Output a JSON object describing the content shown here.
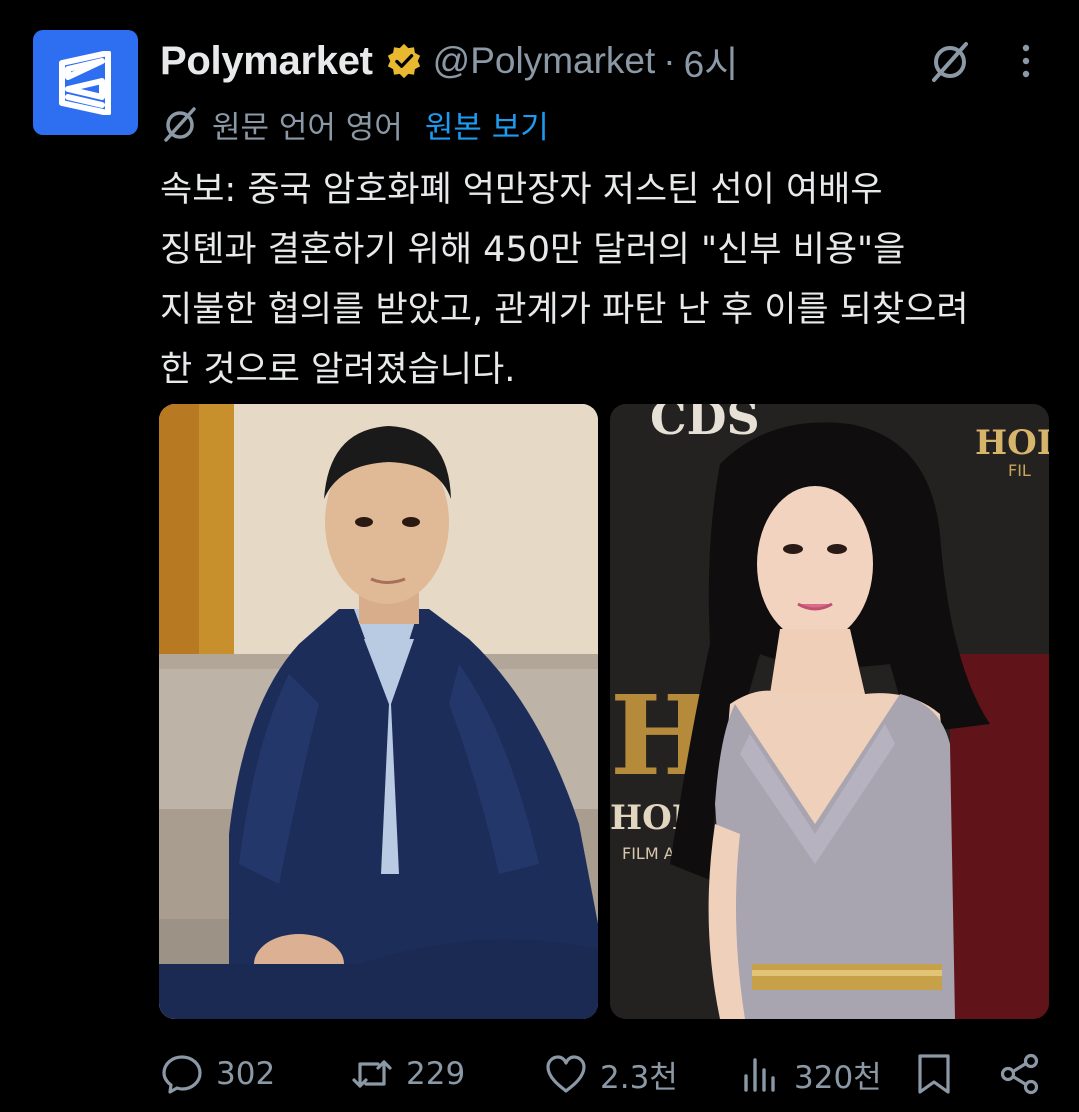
{
  "author": {
    "display_name": "Polymarket",
    "handle": "@Polymarket",
    "separator": "·",
    "time": "6시",
    "avatar_color": "#2e6ff2",
    "verified_color": "#e8b830"
  },
  "translation": {
    "icon": "translate-icon",
    "language_note": "원문 언어 영어",
    "show_original_label": "원본 보기"
  },
  "tweet": {
    "text": "속보: 중국 암호화폐 억만장자 저스틴 선이 여배우\n징톈과 결혼하기 위해 450만 달러의 \"신부 비용\"을\n지불한 협의를 받았고, 관계가 파탄 난 후 이를 되찾으려\n한 것으로 알려졌습니다."
  },
  "media": [
    {
      "description_icon": "photo-man-in-suit"
    },
    {
      "description_icon": "photo-actress-red-carpet"
    }
  ],
  "actions": {
    "reply_count": "302",
    "repost_count": "229",
    "like_count": "2.3천",
    "views_count": "320천"
  },
  "colors": {
    "background": "#000000",
    "text_primary": "#e7e9ea",
    "text_secondary": "#8b98a5",
    "link": "#1d9bf0"
  }
}
